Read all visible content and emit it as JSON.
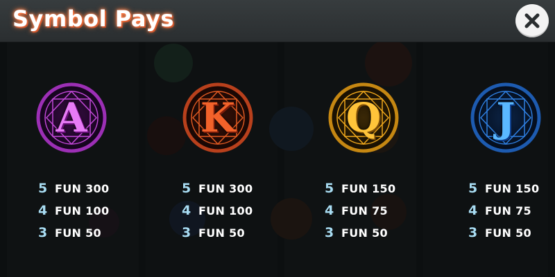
{
  "header": {
    "title": "Symbol Pays"
  },
  "close_icon": "close-icon",
  "symbols": [
    {
      "letter": "A",
      "colors": {
        "ring": "#9c2fb5",
        "glow": "#c248d8",
        "letter_top": "#f7a4ff",
        "letter_bottom": "#b428c8"
      },
      "pays": [
        {
          "count": "5",
          "value": "FUN 300"
        },
        {
          "count": "4",
          "value": "FUN 100"
        },
        {
          "count": "3",
          "value": "FUN 50"
        }
      ]
    },
    {
      "letter": "K",
      "colors": {
        "ring": "#b8401c",
        "glow": "#e05a22",
        "letter_top": "#ffb07a",
        "letter_bottom": "#d0321a"
      },
      "pays": [
        {
          "count": "5",
          "value": "FUN 300"
        },
        {
          "count": "4",
          "value": "FUN 100"
        },
        {
          "count": "3",
          "value": "FUN 50"
        }
      ]
    },
    {
      "letter": "Q",
      "colors": {
        "ring": "#c58712",
        "glow": "#f0a81c",
        "letter_top": "#ffe070",
        "letter_bottom": "#e08c10"
      },
      "pays": [
        {
          "count": "5",
          "value": "FUN 150"
        },
        {
          "count": "4",
          "value": "FUN 75"
        },
        {
          "count": "3",
          "value": "FUN 50"
        }
      ]
    },
    {
      "letter": "J",
      "colors": {
        "ring": "#1d5bb0",
        "glow": "#2f7fe0",
        "letter_top": "#9fe0ff",
        "letter_bottom": "#2a6cd8"
      },
      "pays": [
        {
          "count": "5",
          "value": "FUN 150"
        },
        {
          "count": "4",
          "value": "FUN 75"
        },
        {
          "count": "3",
          "value": "FUN 50"
        }
      ]
    }
  ]
}
